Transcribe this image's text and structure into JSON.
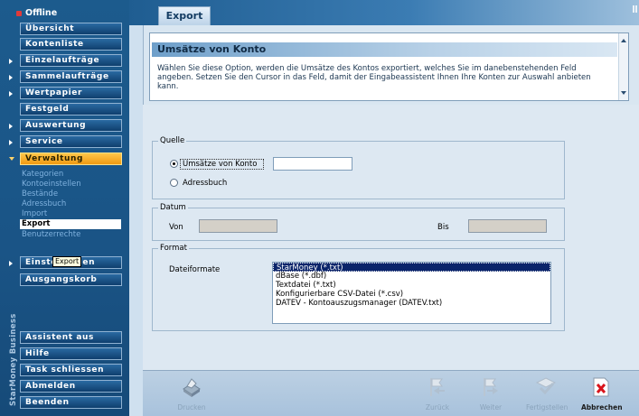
{
  "sidebar": {
    "status": "Offline",
    "brand": "StarMoney Business",
    "nav": [
      {
        "label": "Übersicht"
      },
      {
        "label": "Kontenliste"
      },
      {
        "label": "Einzelaufträge"
      },
      {
        "label": "Sammelaufträge"
      },
      {
        "label": "Wertpapier"
      },
      {
        "label": "Festgeld"
      },
      {
        "label": "Auswertung"
      },
      {
        "label": "Service"
      },
      {
        "label": "Verwaltung"
      }
    ],
    "subnav": [
      {
        "label": "Kategorien"
      },
      {
        "label": "Kontoeinstellen"
      },
      {
        "label": "Bestände"
      },
      {
        "label": "Adressbuch"
      },
      {
        "label": "Import"
      },
      {
        "label": "Export"
      },
      {
        "label": "Benutzerrechte"
      }
    ],
    "nav2": [
      {
        "label": "Einstellungen"
      },
      {
        "label": "Ausgangskorb"
      }
    ],
    "tooltip": "Export",
    "bottom": [
      {
        "label": "Assistent aus"
      },
      {
        "label": "Hilfe"
      },
      {
        "label": "Task schliessen"
      },
      {
        "label": "Abmelden"
      },
      {
        "label": "Beenden"
      }
    ]
  },
  "main": {
    "tab": "Export",
    "info": {
      "title": "Umsätze von Konto",
      "text": "Wählen Sie diese Option, werden die Umsätze des Kontos exportiert, welches Sie im danebenstehenden Feld angeben. Setzen Sie den Cursor in das Feld, damit der Eingabeassistent Ihnen Ihre Konten zur Auswahl anbieten kann."
    },
    "quelle": {
      "legend": "Quelle",
      "option1": "Umsätze von Konto",
      "option2": "Adressbuch",
      "konto_value": ""
    },
    "datum": {
      "legend": "Datum",
      "von_label": "Von",
      "bis_label": "Bis",
      "von_value": "",
      "bis_value": ""
    },
    "format": {
      "legend": "Format",
      "label": "Dateiformate",
      "options": [
        "StarMoney (*.txt)",
        "dBase (*.dbf)",
        "Textdatei (*.txt)",
        "Konfigurierbare CSV-Datei (*.csv)",
        "DATEV - Kontoauszugsmanager (DATEV.txt)"
      ],
      "selected": "StarMoney (*.txt)"
    }
  },
  "toolbar": {
    "drucken": "Drucken",
    "zurueck": "Zurück",
    "weiter": "Weiter",
    "fertigstellen": "Fertigstellen",
    "abbrechen": "Abbrechen"
  },
  "colors": {
    "sidebar": "#1a5486",
    "active_nav": "#f6a922",
    "selection": "#0a246a",
    "cancel_icon": "#d9141b"
  }
}
